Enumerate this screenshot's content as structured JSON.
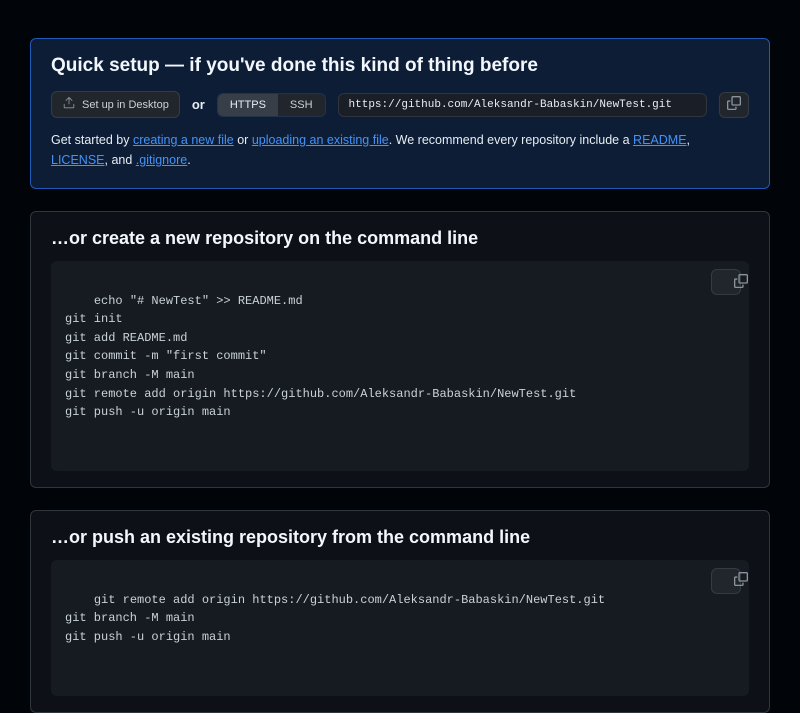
{
  "quick_setup": {
    "title": "Quick setup — if you've done this kind of thing before",
    "desktop_button": "Set up in Desktop",
    "or_label": "or",
    "https_label": "HTTPS",
    "ssh_label": "SSH",
    "clone_url": "https://github.com/Aleksandr-Babaskin/NewTest.git",
    "hint_prefix": "Get started by ",
    "hint_create_link": "creating a new file",
    "hint_or": " or ",
    "hint_upload_link": "uploading an existing file",
    "hint_suffix1": ". We recommend every repository include a ",
    "hint_readme": "README",
    "hint_comma1": ", ",
    "hint_license": "LICENSE",
    "hint_comma2": ", and ",
    "hint_gitignore": ".gitignore",
    "hint_end": "."
  },
  "section1": {
    "title": "…or create a new repository on the command line",
    "code": "echo \"# NewTest\" >> README.md\ngit init\ngit add README.md\ngit commit -m \"first commit\"\ngit branch -M main\ngit remote add origin https://github.com/Aleksandr-Babaskin/NewTest.git\ngit push -u origin main"
  },
  "section2": {
    "title": "…or push an existing repository from the command line",
    "code": "git remote add origin https://github.com/Aleksandr-Babaskin/NewTest.git\ngit branch -M main\ngit push -u origin main"
  }
}
